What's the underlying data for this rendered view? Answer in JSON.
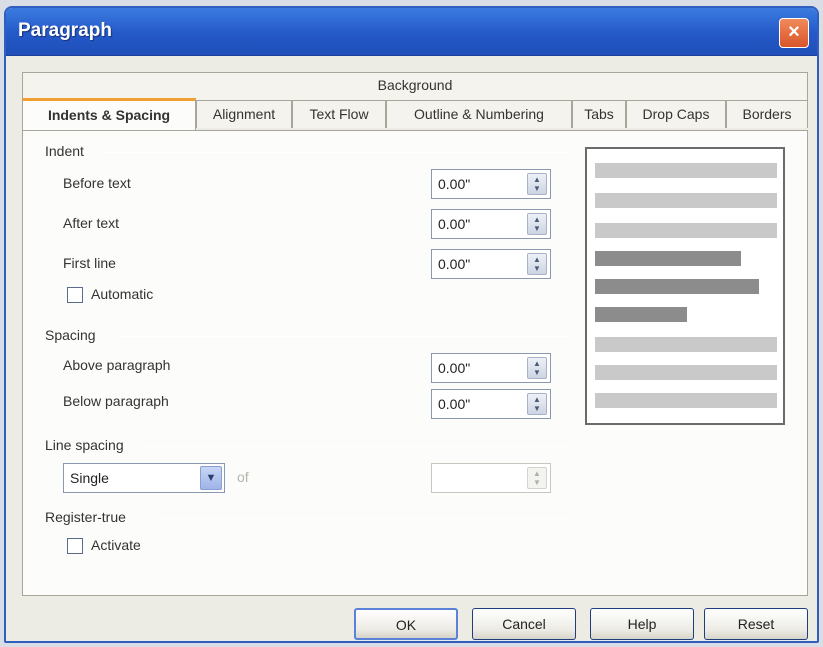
{
  "window": {
    "title": "Paragraph",
    "close_label": "×"
  },
  "tabs": {
    "top_row": [
      "Background"
    ],
    "bottom_row": [
      "Indents & Spacing",
      "Alignment",
      "Text Flow",
      "Outline & Numbering",
      "Tabs",
      "Drop Caps",
      "Borders"
    ],
    "active": "Indents & Spacing"
  },
  "indent": {
    "title": "Indent",
    "before_text": {
      "label": "Before text",
      "value": "0.00\""
    },
    "after_text": {
      "label": "After text",
      "value": "0.00\""
    },
    "first_line": {
      "label": "First line",
      "value": "0.00\""
    },
    "automatic": {
      "label": "Automatic",
      "checked": false
    }
  },
  "spacing": {
    "title": "Spacing",
    "above": {
      "label": "Above paragraph",
      "value": "0.00\""
    },
    "below": {
      "label": "Below paragraph",
      "value": "0.00\""
    }
  },
  "line_spacing": {
    "title": "Line spacing",
    "selected": "Single",
    "of_label": "of",
    "value": ""
  },
  "register_true": {
    "title": "Register-true",
    "activate": {
      "label": "Activate",
      "checked": false
    }
  },
  "buttons": {
    "ok": "OK",
    "cancel": "Cancel",
    "help": "Help",
    "reset": "Reset"
  }
}
